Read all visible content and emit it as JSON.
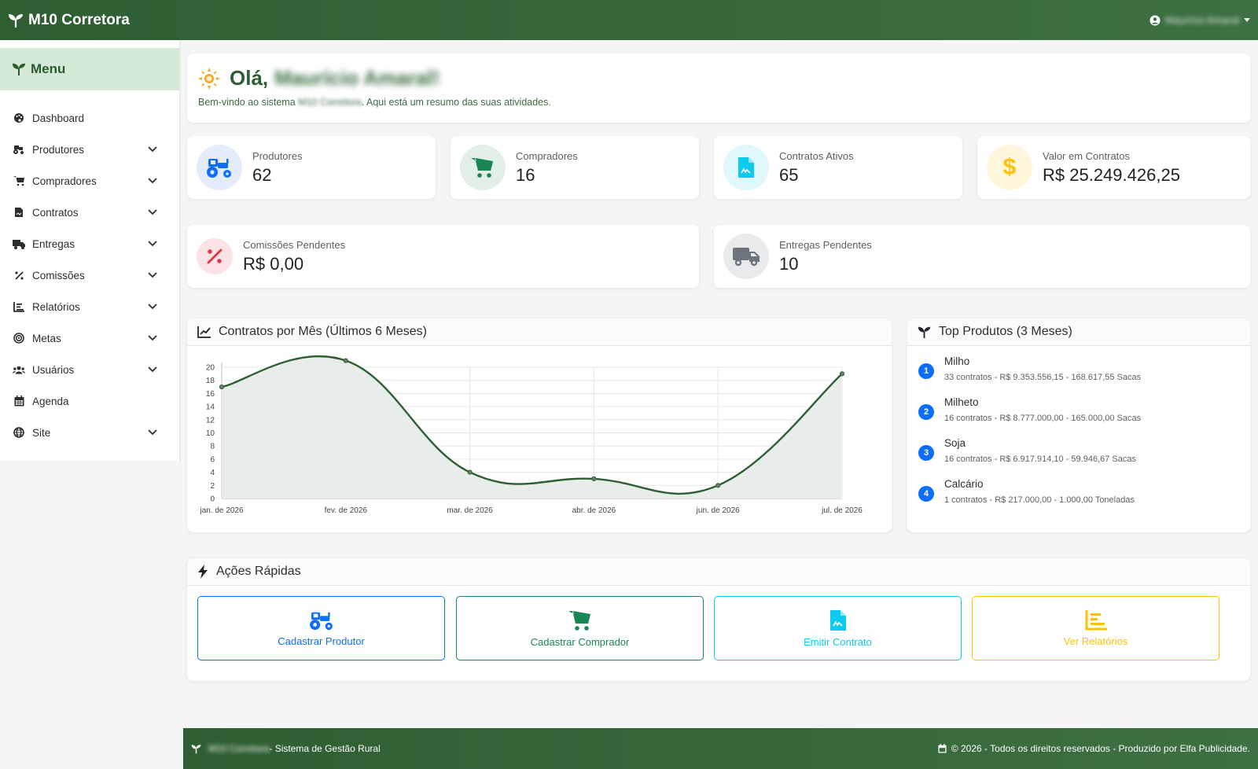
{
  "header": {
    "brand": "M10 Corretora",
    "user_name": "Maurício Amaral"
  },
  "sidebar": {
    "title": "Menu",
    "items": [
      {
        "label": "Dashboard",
        "icon": "palette-icon",
        "has_submenu": false
      },
      {
        "label": "Produtores",
        "icon": "tractor-icon",
        "has_submenu": true
      },
      {
        "label": "Compradores",
        "icon": "cart-icon",
        "has_submenu": true
      },
      {
        "label": "Contratos",
        "icon": "contract-icon",
        "has_submenu": true
      },
      {
        "label": "Entregas",
        "icon": "truck-icon",
        "has_submenu": true
      },
      {
        "label": "Comissões",
        "icon": "percent-icon",
        "has_submenu": true
      },
      {
        "label": "Relatórios",
        "icon": "chart-icon",
        "has_submenu": true
      },
      {
        "label": "Metas",
        "icon": "target-icon",
        "has_submenu": true
      },
      {
        "label": "Usuários",
        "icon": "users-icon",
        "has_submenu": true
      },
      {
        "label": "Agenda",
        "icon": "calendar-icon",
        "has_submenu": false
      },
      {
        "label": "Site",
        "icon": "globe-icon",
        "has_submenu": true
      }
    ]
  },
  "welcome": {
    "greeting": "Olá,",
    "name": "Maurício Amaral!",
    "sub_prefix": "Bem-vindo ao sistema",
    "sub_system": "M10 Corretora",
    "sub_suffix": ". Aqui está um resumo das suas atividades."
  },
  "stats": {
    "produtores": {
      "label": "Produtores",
      "value": "62"
    },
    "compradores": {
      "label": "Compradores",
      "value": "16"
    },
    "contratos": {
      "label": "Contratos Ativos",
      "value": "65"
    },
    "valor": {
      "label": "Valor em Contratos",
      "value": "R$ 25.249.426,25"
    },
    "comissoes": {
      "label": "Comissões Pendentes",
      "value": "R$ 0,00"
    },
    "entregas": {
      "label": "Entregas Pendentes",
      "value": "10"
    }
  },
  "chart_card": {
    "title": "Contratos por Mês (Últimos 6 Meses)"
  },
  "chart_data": {
    "type": "line",
    "title": "Contratos por Mês (Últimos 6 Meses)",
    "categories": [
      "jan. de 2026",
      "fev. de 2026",
      "mar. de 2026",
      "abr. de 2026",
      "jun. de 2026",
      "jul. de 2026"
    ],
    "values": [
      17,
      21,
      4,
      3,
      2,
      19
    ],
    "ylim": [
      0,
      20
    ],
    "yticks": [
      0,
      2,
      4,
      6,
      8,
      10,
      12,
      14,
      16,
      18,
      20
    ],
    "grid": true,
    "fill": true,
    "line_color": "#2e5e33",
    "fill_color": "#e9ede9"
  },
  "top_products": {
    "title": "Top Produtos (3 Meses)",
    "items": [
      {
        "rank": "1",
        "name": "Milho",
        "details": "33 contratos - R$ 9.353.556,15 - 168.617,55 Sacas"
      },
      {
        "rank": "2",
        "name": "Milheto",
        "details": "16 contratos - R$ 8.777.000,00 - 165.000,00 Sacas"
      },
      {
        "rank": "3",
        "name": "Soja",
        "details": "16 contratos - R$ 6.917.914,10 - 59.946,67 Sacas"
      },
      {
        "rank": "4",
        "name": "Calcário",
        "details": "1 contratos - R$ 217.000,00 - 1.000,00 Toneladas"
      }
    ]
  },
  "quick_actions": {
    "title": "Ações Rápidas",
    "buttons": [
      {
        "label": "Cadastrar Produtor",
        "color": "#0d6efd"
      },
      {
        "label": "Cadastrar Comprador",
        "color": "#198754"
      },
      {
        "label": "Emitir Contrato",
        "color": "#0dcaf0"
      },
      {
        "label": "Ver Relatórios",
        "color": "#ffc107"
      }
    ]
  },
  "footer": {
    "system_name": "M10 Corretora",
    "tagline": " - Sistema de Gestão Rural",
    "copyright": "© 2026 - Todos os direitos reservados - Produzido por Elfa Publicidade."
  },
  "colors": {
    "primary_green": "#2e5e33",
    "menu_active_bg": "#d5e9d7"
  }
}
